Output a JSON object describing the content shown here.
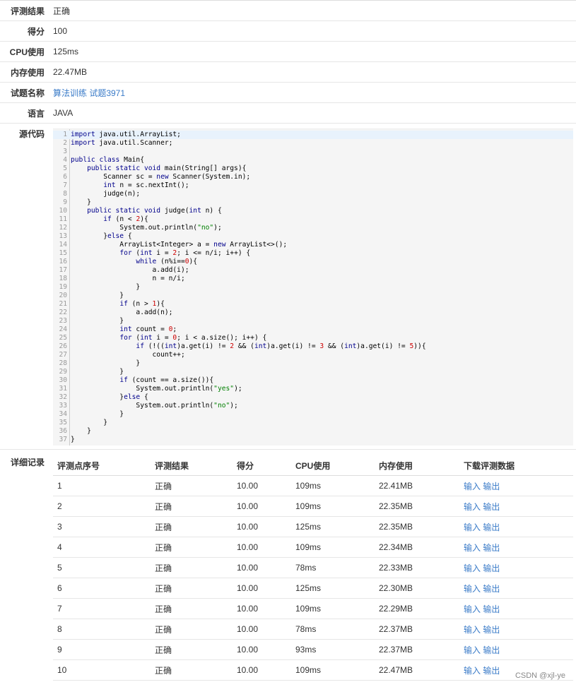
{
  "summary": {
    "result_label": "评测结果",
    "result_value": "正确",
    "score_label": "得分",
    "score_value": "100",
    "cpu_label": "CPU使用",
    "cpu_value": "125ms",
    "mem_label": "内存使用",
    "mem_value": "22.47MB",
    "problem_label": "试题名称",
    "problem_value": "算法训练 试题3971",
    "lang_label": "语言",
    "lang_value": "JAVA",
    "source_label": "源代码"
  },
  "code_lines": [
    "import java.util.ArrayList;",
    "import java.util.Scanner;",
    "",
    "public class Main{",
    "    public static void main(String[] args){",
    "        Scanner sc = new Scanner(System.in);",
    "        int n = sc.nextInt();",
    "        judge(n);",
    "    }",
    "    public static void judge(int n) {",
    "        if (n < 2){",
    "            System.out.println(\"no\");",
    "        }else {",
    "            ArrayList<Integer> a = new ArrayList<>();",
    "            for (int i = 2; i <= n/i; i++) {",
    "                while (n%i==0){",
    "                    a.add(i);",
    "                    n = n/i;",
    "                }",
    "            }",
    "            if (n > 1){",
    "                a.add(n);",
    "            }",
    "            int count = 0;",
    "            for (int i = 0; i < a.size(); i++) {",
    "                if (!((int)a.get(i) != 2 && (int)a.get(i) != 3 && (int)a.get(i) != 5)){",
    "                    count++;",
    "                }",
    "            }",
    "            if (count == a.size()){",
    "                System.out.println(\"yes\");",
    "            }else {",
    "                System.out.println(\"no\");",
    "            }",
    "        }",
    "    }",
    "}"
  ],
  "detail": {
    "label": "详细记录",
    "headers": [
      "评测点序号",
      "评测结果",
      "得分",
      "CPU使用",
      "内存使用",
      "下载评测数据"
    ],
    "input_label": "输入",
    "output_label": "输出",
    "rows": [
      [
        "1",
        "正确",
        "10.00",
        "109ms",
        "22.41MB"
      ],
      [
        "2",
        "正确",
        "10.00",
        "109ms",
        "22.35MB"
      ],
      [
        "3",
        "正确",
        "10.00",
        "125ms",
        "22.35MB"
      ],
      [
        "4",
        "正确",
        "10.00",
        "109ms",
        "22.34MB"
      ],
      [
        "5",
        "正确",
        "10.00",
        "78ms",
        "22.33MB"
      ],
      [
        "6",
        "正确",
        "10.00",
        "125ms",
        "22.30MB"
      ],
      [
        "7",
        "正确",
        "10.00",
        "109ms",
        "22.29MB"
      ],
      [
        "8",
        "正确",
        "10.00",
        "78ms",
        "22.37MB"
      ],
      [
        "9",
        "正确",
        "10.00",
        "93ms",
        "22.37MB"
      ],
      [
        "10",
        "正确",
        "10.00",
        "109ms",
        "22.47MB"
      ]
    ]
  },
  "watermark": "CSDN @xjl-ye",
  "colors": {
    "link": "#3a7bc8",
    "code_bg": "#f5f5f5",
    "highlight": "#e8f2fc"
  }
}
